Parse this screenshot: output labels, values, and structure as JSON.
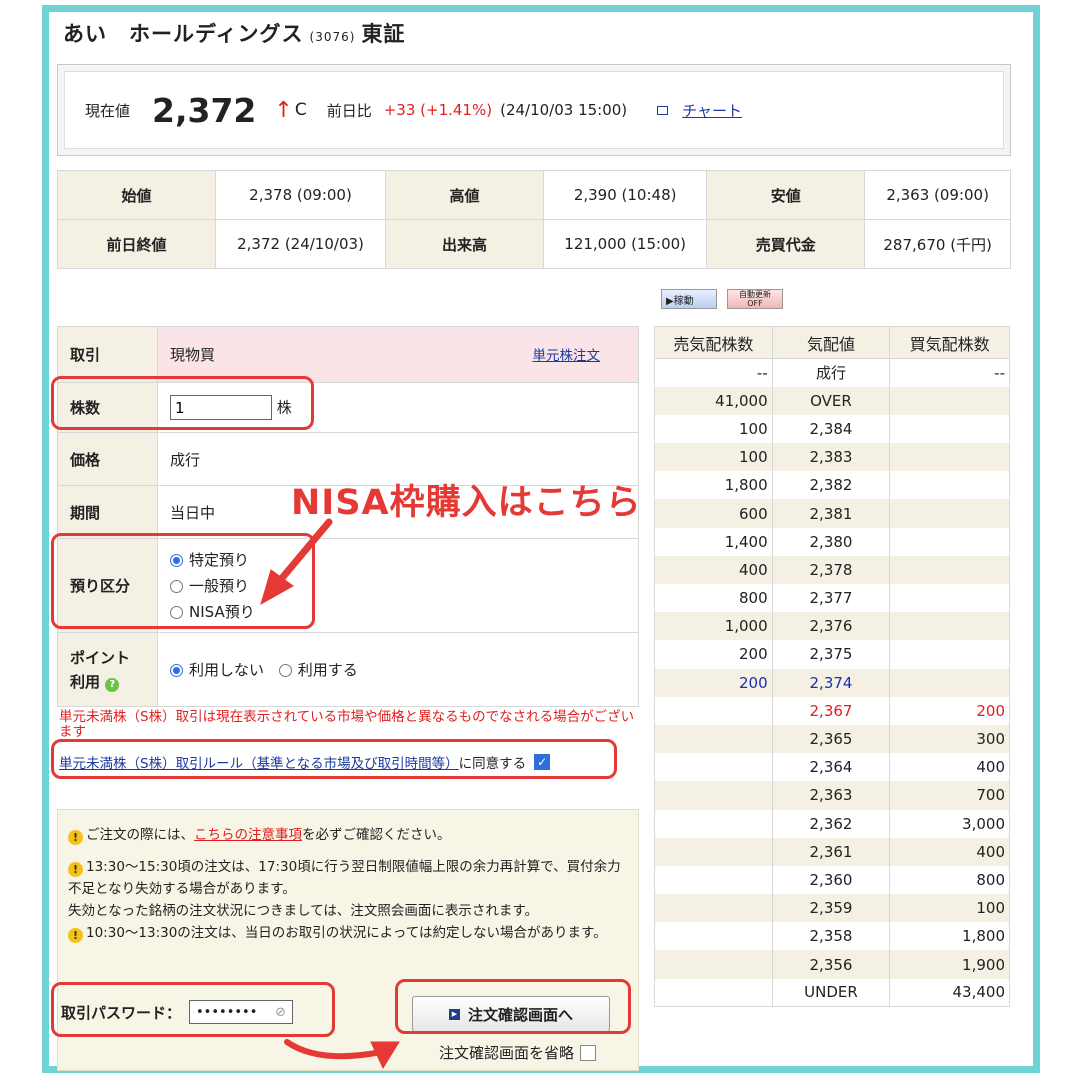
{
  "stock": {
    "name": "あい　ホールディングス",
    "code": "(3076)",
    "market": "東証"
  },
  "price": {
    "label": "現在値",
    "value": "2,372",
    "arrow": "↑",
    "suffix": "C",
    "change_label": "前日比",
    "change": "+33 (+1.41%)",
    "datetime": "(24/10/03 15:00)",
    "chart_link": "チャート"
  },
  "stats": [
    [
      {
        "h": "始値"
      },
      {
        "v": "2,378 (09:00)"
      },
      {
        "h": "高値"
      },
      {
        "v": "2,390 (10:48)"
      },
      {
        "h": "安値"
      },
      {
        "v": "2,363 (09:00)"
      }
    ],
    [
      {
        "h": "前日終値"
      },
      {
        "v": "2,372 (24/10/03)"
      },
      {
        "h": "出来高"
      },
      {
        "v": "121,000 (15:00)"
      },
      {
        "h": "売買代金"
      },
      {
        "v": "287,670 (千円)"
      }
    ]
  ],
  "buttons": {
    "live": "▶稼動",
    "auto_refresh": "自動更新OFF"
  },
  "order": {
    "trade_label": "取引",
    "trade_value": "現物買",
    "unit_order_link": "単元株注文",
    "qty_label": "株数",
    "qty_value": "1",
    "qty_unit": "株",
    "price_label": "価格",
    "price_value": "成行",
    "period_label": "期間",
    "period_value": "当日中",
    "account_label": "預り区分",
    "account_options": [
      "特定預り",
      "一般預り",
      "NISA預り"
    ],
    "points_label_1": "ポイント",
    "points_label_2": "利用",
    "points_options": [
      "利用しない",
      "利用する"
    ]
  },
  "warning_text": "単元未満株（S株）取引は現在表示されている市場や価格と異なるものでなされる場合がございます",
  "agree": {
    "link": "単元未満株（S株）取引ルール（基準となる市場及び取引時間等）",
    "text": "に同意する"
  },
  "notes": {
    "n1_pre": "ご注文の際には、",
    "n1_link": "こちらの注意事項",
    "n1_post": "を必ずご確認ください。",
    "n2": "13:30〜15:30頃の注文は、17:30頃に行う翌日制限値幅上限の余力再計算で、買付余力不足となり失効する場合があります。",
    "n2b": "失効となった銘柄の注文状況につきましては、注文照会画面に表示されます。",
    "n3": "10:30〜13:30の注文は、当日のお取引の状況によっては約定しない場合があります。"
  },
  "password": {
    "label": "取引パスワード：",
    "value": "••••••••"
  },
  "confirm_button": "注文確認画面へ",
  "skip_label": "注文確認画面を省略",
  "annotation": "NISA枠購入はこちら",
  "board": {
    "headers": [
      "売気配株数",
      "気配値",
      "買気配株数"
    ],
    "rows": [
      {
        "ask": "--",
        "price": "成行",
        "bid": "--"
      },
      {
        "ask": "41,000",
        "price": "OVER",
        "bid": ""
      },
      {
        "ask": "100",
        "price": "2,384",
        "bid": ""
      },
      {
        "ask": "100",
        "price": "2,383",
        "bid": ""
      },
      {
        "ask": "1,800",
        "price": "2,382",
        "bid": ""
      },
      {
        "ask": "600",
        "price": "2,381",
        "bid": ""
      },
      {
        "ask": "1,400",
        "price": "2,380",
        "bid": ""
      },
      {
        "ask": "400",
        "price": "2,378",
        "bid": ""
      },
      {
        "ask": "800",
        "price": "2,377",
        "bid": ""
      },
      {
        "ask": "1,000",
        "price": "2,376",
        "bid": ""
      },
      {
        "ask": "200",
        "price": "2,375",
        "bid": ""
      },
      {
        "ask": "200",
        "price": "2,374",
        "bid": "",
        "hl": "blue"
      },
      {
        "ask": "",
        "price": "2,367",
        "bid": "200",
        "hl": "red"
      },
      {
        "ask": "",
        "price": "2,365",
        "bid": "300"
      },
      {
        "ask": "",
        "price": "2,364",
        "bid": "400"
      },
      {
        "ask": "",
        "price": "2,363",
        "bid": "700"
      },
      {
        "ask": "",
        "price": "2,362",
        "bid": "3,000"
      },
      {
        "ask": "",
        "price": "2,361",
        "bid": "400"
      },
      {
        "ask": "",
        "price": "2,360",
        "bid": "800"
      },
      {
        "ask": "",
        "price": "2,359",
        "bid": "100"
      },
      {
        "ask": "",
        "price": "2,358",
        "bid": "1,800"
      },
      {
        "ask": "",
        "price": "2,356",
        "bid": "1,900"
      },
      {
        "ask": "",
        "price": "UNDER",
        "bid": "43,400"
      }
    ]
  },
  "colors": {
    "frame": "#6fd3d6",
    "annotation": "#e53935",
    "up": "#e02020",
    "header_bg": "#f4f1e4"
  }
}
